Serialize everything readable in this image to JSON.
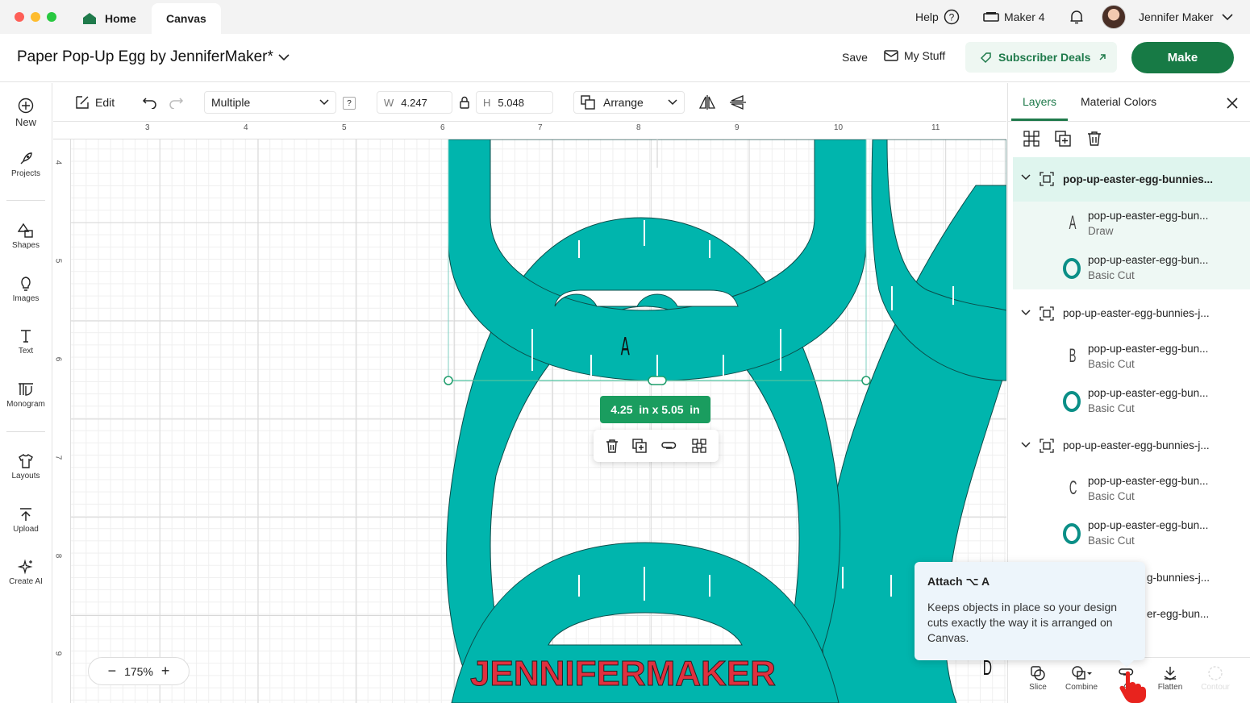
{
  "tabs": {
    "home": "Home",
    "canvas": "Canvas"
  },
  "topbar": {
    "help": "Help",
    "machine": "Maker 4",
    "user": "Jennifer Maker"
  },
  "project": {
    "title": "Paper Pop-Up Egg by JenniferMaker*"
  },
  "appbar": {
    "save": "Save",
    "my_stuff": "My Stuff",
    "subscriber_deals": "Subscriber Deals",
    "make": "Make"
  },
  "sidebar": {
    "items": [
      "New",
      "Projects",
      "Shapes",
      "Images",
      "Text",
      "Monogram",
      "Layouts",
      "Upload",
      "Create AI"
    ]
  },
  "toolbar": {
    "edit": "Edit",
    "operation": "Multiple",
    "help_badge": "?",
    "w_label": "W",
    "w_value": "4.247",
    "h_label": "H",
    "h_value": "5.048",
    "arrange": "Arrange"
  },
  "ruler": {
    "top": [
      "3",
      "4",
      "5",
      "6",
      "7",
      "8",
      "9",
      "10",
      "11"
    ],
    "left": [
      "4",
      "5",
      "6",
      "7",
      "8",
      "9"
    ]
  },
  "canvas": {
    "size_badge": "4.25  in x 5.05  in",
    "zoom": "175%",
    "zoom_minus": "−",
    "zoom_plus": "+",
    "watermark": "JENNIFERMAKER",
    "letters": [
      "A",
      "D"
    ]
  },
  "panel": {
    "tabs": [
      "Layers",
      "Material Colors"
    ],
    "groups": [
      {
        "name": "pop-up-easter-egg-bunnies...",
        "children": [
          {
            "name": "pop-up-easter-egg-bun...",
            "op": "Draw",
            "glyph": "A"
          },
          {
            "name": "pop-up-easter-egg-bun...",
            "op": "Basic Cut"
          }
        ]
      },
      {
        "name": "pop-up-easter-egg-bunnies-j...",
        "children": [
          {
            "name": "pop-up-easter-egg-bun...",
            "op": "Basic Cut",
            "glyph": "B"
          },
          {
            "name": "pop-up-easter-egg-bun...",
            "op": "Basic Cut"
          }
        ]
      },
      {
        "name": "pop-up-easter-egg-bunnies-j...",
        "children": [
          {
            "name": "pop-up-easter-egg-bun...",
            "op": "Basic Cut",
            "glyph": "C"
          },
          {
            "name": "pop-up-easter-egg-bun...",
            "op": "Basic Cut"
          }
        ]
      }
    ],
    "partial": [
      "g-bunnies-j...",
      "er-egg-bun..."
    ]
  },
  "tooltip": {
    "title": "Attach ⌥ A",
    "body": "Keeps objects in place so your design cuts exactly the way it is arranged on Canvas."
  },
  "bottom_actions": [
    "Slice",
    "Combine",
    "At",
    "Flatten",
    "Contour"
  ],
  "colors": {
    "teal": "#00b5ad",
    "accent": "#1f7a4b",
    "make_bg": "#177a45",
    "selected_row": "#dff5ee"
  }
}
